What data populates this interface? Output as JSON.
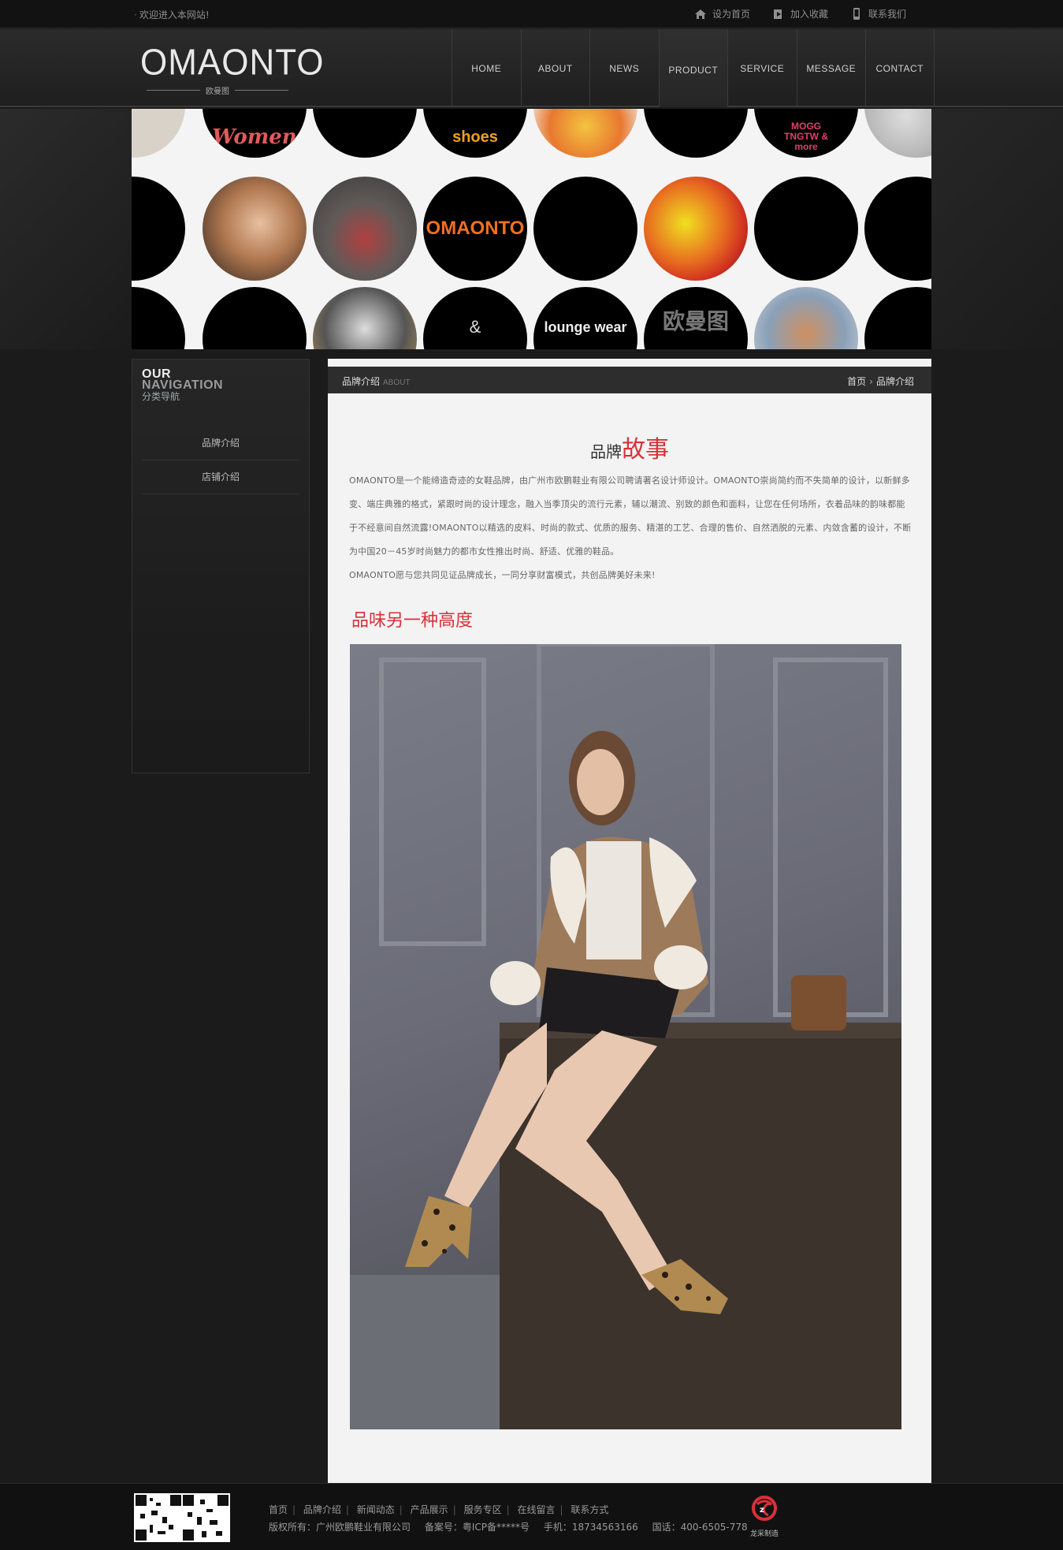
{
  "topbar": {
    "welcome": "欢迎进入本网站!",
    "links": [
      {
        "label": "设为首页",
        "icon": "home-icon"
      },
      {
        "label": "加入收藏",
        "icon": "bookmark-icon"
      },
      {
        "label": "联系我们",
        "icon": "phone-icon"
      }
    ]
  },
  "header": {
    "logo": "OMAONTO",
    "logo_sub": "欧曼图",
    "nav": [
      "HOME",
      "ABOUT",
      "NEWS",
      "PRODUCT",
      "SERVICE",
      "MESSAGE",
      "CONTACT"
    ]
  },
  "banner": {
    "texts": [
      "Women",
      "shoes",
      "MOGG TNGTW & more",
      "OMAONTO",
      "&",
      "lounge wear",
      "欧曼图"
    ]
  },
  "sidebar": {
    "title_line1": "OUR",
    "title_line2": "NAVIGATION",
    "title_line3": "分类导航",
    "items": [
      "品牌介绍",
      "店铺介绍"
    ]
  },
  "main": {
    "heading": "品牌介绍",
    "heading_sub": "ABOUT",
    "breadcrumb": {
      "home": "首页",
      "current": "品牌介绍"
    },
    "story_title_a": "品牌",
    "story_title_b": "故事",
    "paragraphs": [
      "OMAONTO是一个能缔造奇迹的女鞋品牌，由广州市欧鹏鞋业有限公司聘请著名设计师设计。OMAONTO崇尚简约而不失简单的设计，以新鲜多变、端庄典雅的格式，紧跟时尚的设计理念，融入当季顶尖的流行元素，辅以潮流、别致的颜色和面料，让您在任何场所，衣着品味的韵味都能于不经意间自然流露!OMAONTO以精选的皮料、时尚的款式、优质的服务、精湛的工艺、合理的售价、自然洒脱的元素、内敛含蓄的设计，不断为中国20－45岁时尚魅力的都市女性推出时尚、舒适、优雅的鞋品。",
      "OMAONTO愿与您共同见证品牌成长，一同分享财富模式，共创品牌美好未来!"
    ],
    "slogan": "品味另一种高度"
  },
  "footer": {
    "links": [
      "首页",
      "品牌介绍",
      "新闻动态",
      "产品展示",
      "服务专区",
      "在线留言",
      "联系方式"
    ],
    "copyright": "版权所有：广州欧鹏鞋业有限公司",
    "icp": "备案号：粤ICP备*****号",
    "mobile": "手机：18734563166",
    "phone": "国话：400-6505-778",
    "badge_text": "龙采制造"
  },
  "colors": {
    "accent": "#d8303a",
    "page_bg": "#1b1b1b",
    "content_bg": "#f3f3f3"
  }
}
